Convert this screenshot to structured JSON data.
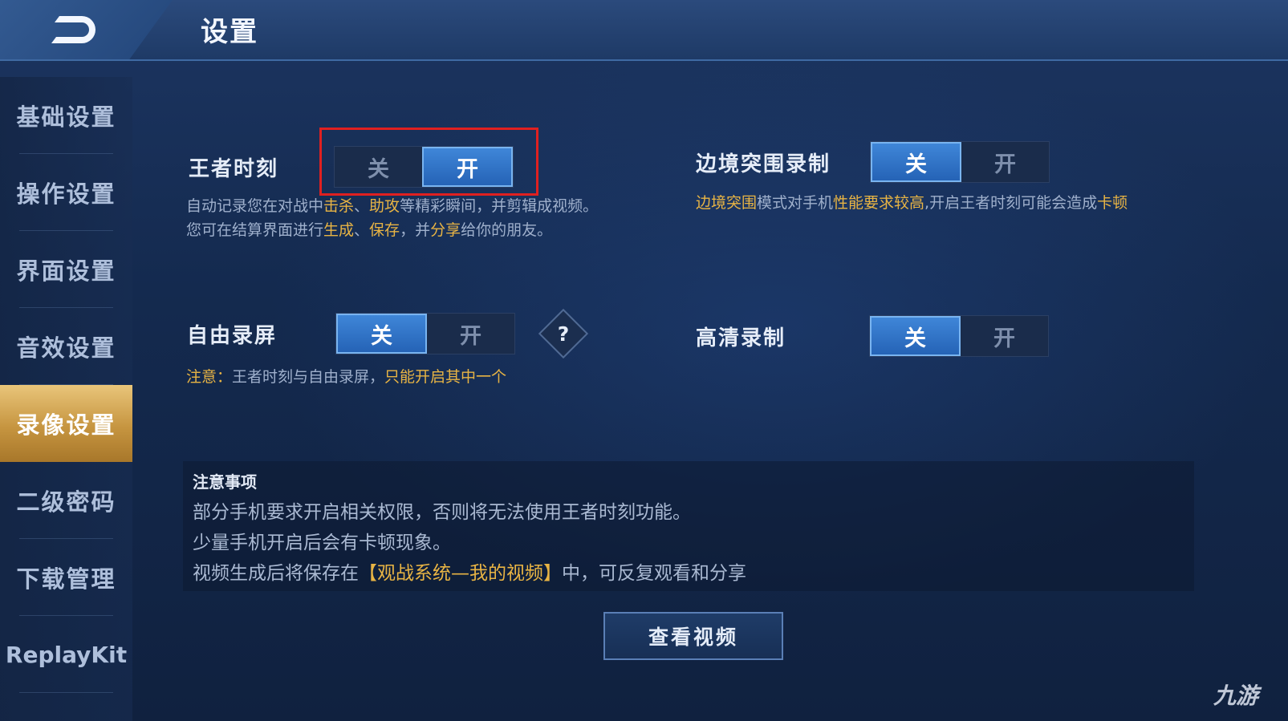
{
  "header": {
    "title": "设置"
  },
  "sidebar": {
    "items": [
      {
        "label": "基础设置"
      },
      {
        "label": "操作设置"
      },
      {
        "label": "界面设置"
      },
      {
        "label": "音效设置"
      },
      {
        "label": "录像设置",
        "active": true
      },
      {
        "label": "二级密码"
      },
      {
        "label": "下载管理"
      },
      {
        "label": "ReplayKit"
      }
    ]
  },
  "settings": {
    "moment": {
      "label": "王者时刻",
      "off": "关",
      "on": "开",
      "value": "开",
      "desc1_a": "自动记录您在对战中",
      "desc1_b": "击杀",
      "desc1_c": "、",
      "desc1_d": "助攻",
      "desc1_e": "等精彩瞬间，并剪辑成视频。",
      "desc2_a": "您可在结算界面进行",
      "desc2_b": "生成",
      "desc2_c": "、",
      "desc2_d": "保存",
      "desc2_e": "，并",
      "desc2_f": "分享",
      "desc2_g": "给你的朋友。"
    },
    "border": {
      "label": "边境突围录制",
      "off": "关",
      "on": "开",
      "value": "关",
      "desc_a": "边境突围",
      "desc_b": "模式对手机",
      "desc_c": "性能要求较高",
      "desc_d": ",开启王者时刻可能会造成",
      "desc_e": "卡顿"
    },
    "free": {
      "label": "自由录屏",
      "off": "关",
      "on": "开",
      "value": "关",
      "help": "?",
      "note_a": "注意：",
      "note_b": "王者时刻与自由录屏，",
      "note_c": "只能开启其中一个"
    },
    "hd": {
      "label": "高清录制",
      "off": "关",
      "on": "开",
      "value": "关"
    }
  },
  "notes": {
    "title": "注意事项",
    "line1": "部分手机要求开启相关权限，否则将无法使用王者时刻功能。",
    "line2": "少量手机开启后会有卡顿现象。",
    "line3_a": "视频生成后将保存在",
    "line3_b": "【观战系统—我的视频】",
    "line3_c": "中，可反复观看和分享"
  },
  "view_button": "查看视频",
  "watermark": "九游",
  "colors": {
    "accent": "#2f74c8",
    "highlight": "#e8b444",
    "active_tab": "#c69540",
    "annotation": "#e02020"
  }
}
